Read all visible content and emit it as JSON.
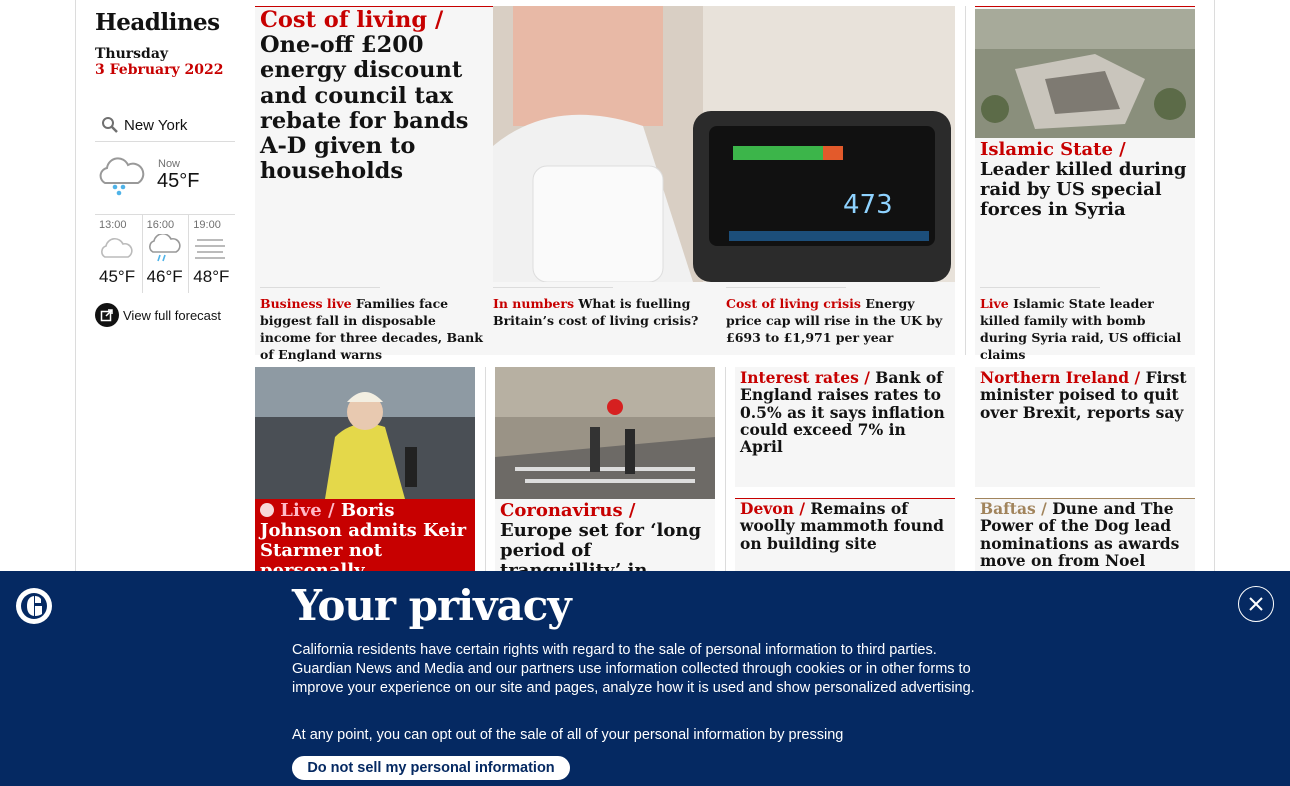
{
  "sidebar": {
    "title": "Headlines",
    "day": "Thursday",
    "date": "3 February 2022",
    "weather": {
      "location": "New York",
      "now_label": "Now",
      "now_temp": "45°F",
      "forecast": [
        {
          "time": "13:00",
          "temp": "45°F",
          "icon": "cloud-icon"
        },
        {
          "time": "16:00",
          "temp": "46°F",
          "icon": "rain-cloud-icon"
        },
        {
          "time": "19:00",
          "temp": "48°F",
          "icon": "fog-icon"
        }
      ],
      "full_forecast_label": "View full forecast"
    }
  },
  "stories": {
    "main": {
      "kicker": "Cost of living /",
      "headline": "One-off £200 energy discount and council tax rebate for bands A-D given to households"
    },
    "main_subs": [
      {
        "kicker": "Business live",
        "text": "Families face biggest fall in disposable income for three decades, Bank of England warns"
      },
      {
        "kicker": "In numbers",
        "text": "What is fuelling Britain’s cost of living crisis?"
      },
      {
        "kicker": "Cost of living crisis",
        "text": "Energy price cap will rise in the UK by £693 to £1,971 per year"
      }
    ],
    "syria": {
      "kicker": "Islamic State /",
      "headline": "Leader killed during raid by US special forces in Syria"
    },
    "syria_sub": {
      "kicker": "Live",
      "text": "Islamic State leader killed family with bomb during Syria raid, US official claims"
    },
    "johnson": {
      "kicker": "Live /",
      "headline": "Boris Johnson admits Keir Starmer not personally"
    },
    "covid": {
      "kicker": "Coronavirus /",
      "headline": "Europe set for ‘long period of tranquillity’ in"
    },
    "rates": {
      "kicker": "Interest rates /",
      "headline": "Bank of England raises rates to 0.5% as it says inflation could exceed 7% in April"
    },
    "ni": {
      "kicker": "Northern Ireland /",
      "headline": "First minister poised to quit over Brexit, reports say"
    },
    "devon": {
      "kicker": "Devon /",
      "headline": "Remains of woolly mammoth found on building site"
    },
    "baftas": {
      "kicker": "Baftas /",
      "headline": "Dune and The Power of the Dog lead nominations as awards move on from Noel Clarke"
    }
  },
  "privacy": {
    "title": "Your privacy",
    "paragraph": "California residents have certain rights with regard to the sale of personal information to third parties. Guardian News and Media and our partners use information collected through cookies or in other forms to improve your experience on our site and pages, analyze how it is used and show personalized advertising.",
    "optout_text": "At any point, you can opt out of the sale of all of your personal information by pressing",
    "button_label": "Do not sell my personal information"
  },
  "colors": {
    "news_red": "#c70000",
    "culture_gold": "#a1845c",
    "banner_blue": "#052962"
  }
}
